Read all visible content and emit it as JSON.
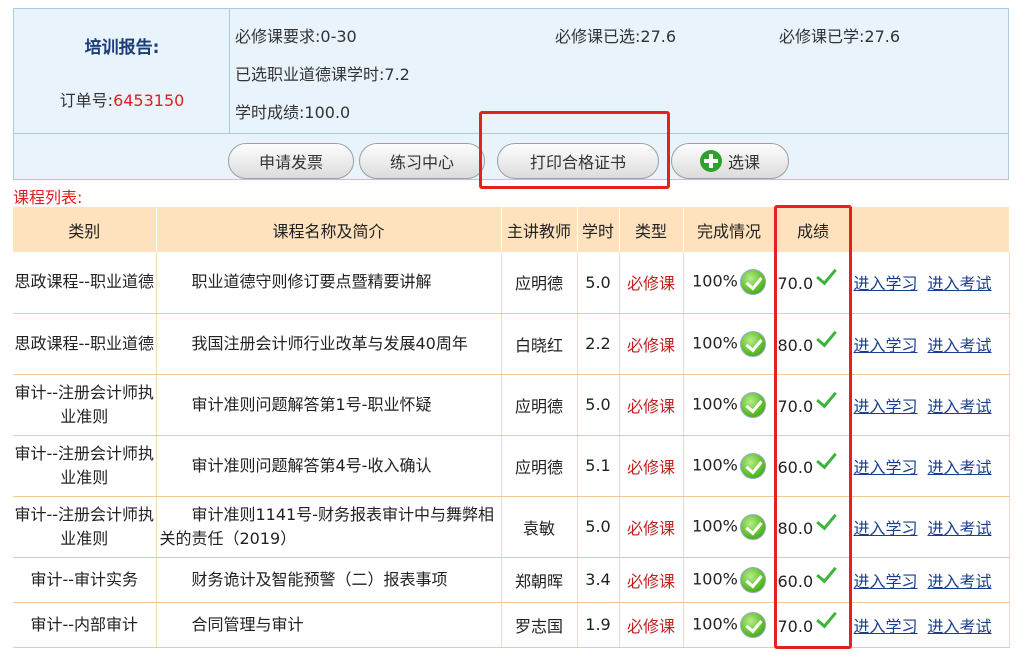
{
  "report": {
    "title": "培训报告:",
    "order_label": "订单号:",
    "order_number": "6453150",
    "required_label": "必修课要求:",
    "required_value": "0-30",
    "selected_label": "必修课已选:",
    "selected_value": "27.6",
    "learned_label": "必修课已学:",
    "learned_value": "27.6",
    "ethics_label": "已选职业道德课学时:",
    "ethics_value": "7.2",
    "score_label": "学时成绩:",
    "score_value": "100.0"
  },
  "buttons": {
    "invoice": "申请发票",
    "practice": "练习中心",
    "print_certificate": "打印合格证书",
    "select_course": "选课"
  },
  "list_title": "课程列表:",
  "table": {
    "headers": [
      "类别",
      "课程名称及简介",
      "主讲教师",
      "学时",
      "类型",
      "完成情况",
      "成绩",
      ""
    ],
    "rows": [
      {
        "category": "思政课程--职业道德",
        "name": "职业道德守则修订要点暨精要讲解",
        "teacher": "应明德",
        "hours": "5.0",
        "type": "必修课",
        "completion": "100%",
        "score": "70.0",
        "study": "进入学习",
        "exam": "进入考试"
      },
      {
        "category": "思政课程--职业道德",
        "name": "我国注册会计师行业改革与发展40周年",
        "teacher": "白晓红",
        "hours": "2.2",
        "type": "必修课",
        "completion": "100%",
        "score": "80.0",
        "study": "进入学习",
        "exam": "进入考试"
      },
      {
        "category": "审计--注册会计师执业准则",
        "name": "审计准则问题解答第1号-职业怀疑",
        "teacher": "应明德",
        "hours": "5.0",
        "type": "必修课",
        "completion": "100%",
        "score": "70.0",
        "study": "进入学习",
        "exam": "进入考试"
      },
      {
        "category": "审计--注册会计师执业准则",
        "name": "审计准则问题解答第4号-收入确认",
        "teacher": "应明德",
        "hours": "5.1",
        "type": "必修课",
        "completion": "100%",
        "score": "60.0",
        "study": "进入学习",
        "exam": "进入考试"
      },
      {
        "category": "审计--注册会计师执业准则",
        "name": "审计准则1141号-财务报表审计中与舞弊相关的责任（2019）",
        "teacher": "袁敏",
        "hours": "5.0",
        "type": "必修课",
        "completion": "100%",
        "score": "80.0",
        "study": "进入学习",
        "exam": "进入考试"
      },
      {
        "category": "审计--审计实务",
        "name": "财务诡计及智能预警（二）报表事项",
        "teacher": "郑朝晖",
        "hours": "3.4",
        "type": "必修课",
        "completion": "100%",
        "score": "60.0",
        "study": "进入学习",
        "exam": "进入考试"
      },
      {
        "category": "审计--内部审计",
        "name": "合同管理与审计",
        "teacher": "罗志国",
        "hours": "1.9",
        "type": "必修课",
        "completion": "100%",
        "score": "70.0",
        "study": "进入学习",
        "exam": "进入考试"
      }
    ]
  },
  "colors": {
    "highlight_box": "#e5211d",
    "required_type": "#c02020",
    "header_bg": "#fde2bd",
    "report_bg": "#e8f3fb"
  }
}
